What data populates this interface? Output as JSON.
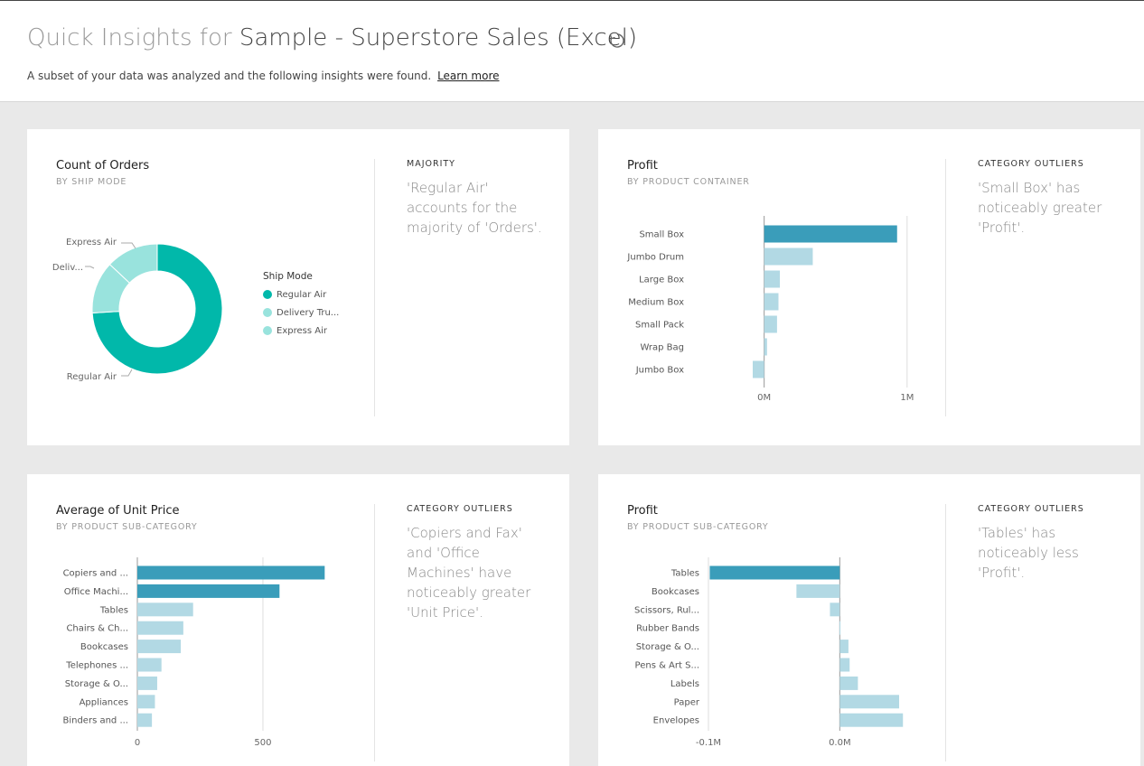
{
  "header": {
    "title_prefix": "Quick Insights for",
    "dataset_name": "Sample - Superstore Sales (Excel)",
    "subtitle": "A subset of your data was analyzed and the following insights were found.",
    "learn_more": "Learn more"
  },
  "icons": {
    "refresh": "refresh-icon"
  },
  "colors": {
    "highlight": "#3a9dba",
    "normal": "#b2d9e4",
    "donut_primary": "#01b8aa",
    "donut_secondary": "#99e3dd"
  },
  "cards": [
    {
      "title": "Count of Orders",
      "subtitle": "BY SHIP MODE",
      "insight_type": "MAJORITY",
      "insight_text": "'Regular Air' accounts for the majority of 'Orders'.",
      "legend_title": "Ship Mode",
      "slice_labels": [
        "Express Air",
        "Deliv...",
        "Regular Air"
      ],
      "legend_labels": [
        "Regular Air",
        "Delivery Tru...",
        "Express Air"
      ]
    },
    {
      "title": "Profit",
      "subtitle": "BY PRODUCT CONTAINER",
      "insight_type": "CATEGORY OUTLIERS",
      "insight_text": "'Small Box' has noticeably greater 'Profit'."
    },
    {
      "title": "Average of Unit Price",
      "subtitle": "BY PRODUCT SUB-CATEGORY",
      "insight_type": "CATEGORY OUTLIERS",
      "insight_text": "'Copiers and Fax' and 'Office Machines' have noticeably greater 'Unit Price'."
    },
    {
      "title": "Profit",
      "subtitle": "BY PRODUCT SUB-CATEGORY",
      "insight_type": "CATEGORY OUTLIERS",
      "insight_text": "'Tables' has noticeably less 'Profit'."
    }
  ],
  "chart_data": [
    {
      "type": "pie",
      "title": "Count of Orders",
      "categories": [
        "Regular Air",
        "Delivery Truck",
        "Express Air"
      ],
      "values": [
        74,
        13,
        13
      ],
      "legend_title": "Ship Mode",
      "legend": "right"
    },
    {
      "type": "bar",
      "orientation": "horizontal",
      "title": "Profit",
      "xlabel": "",
      "ylabel": "",
      "categories": [
        "Small Box",
        "Jumbo Drum",
        "Large Box",
        "Medium Box",
        "Small Pack",
        "Wrap Bag",
        "Jumbo Box"
      ],
      "values": [
        0.93,
        0.34,
        0.11,
        0.1,
        0.09,
        0.02,
        -0.08
      ],
      "highlight": [
        0
      ],
      "xlim": [
        -0.08,
        1.02
      ],
      "ticks": [
        0,
        1
      ],
      "tick_labels": [
        "0M",
        "1M"
      ],
      "grid": true
    },
    {
      "type": "bar",
      "orientation": "horizontal",
      "title": "Average of Unit Price",
      "xlabel": "",
      "ylabel": "",
      "categories": [
        "Copiers and ...",
        "Office Machi...",
        "Tables",
        "Chairs & Ch...",
        "Bookcases",
        "Telephones ...",
        "Storage & O...",
        "Appliances",
        "Binders and ..."
      ],
      "values": [
        746,
        566,
        222,
        183,
        173,
        96,
        79,
        70,
        58
      ],
      "highlight": [
        0,
        1
      ],
      "xlim": [
        0,
        770
      ],
      "ticks": [
        0,
        500
      ],
      "tick_labels": [
        "0",
        "500"
      ],
      "grid": true
    },
    {
      "type": "bar",
      "orientation": "horizontal",
      "title": "Profit",
      "xlabel": "",
      "ylabel": "",
      "categories": [
        "Tables",
        "Bookcases",
        "Scissors, Rul...",
        "Rubber Bands",
        "Storage & O...",
        "Pens & Art S...",
        "Labels",
        "Paper",
        "Envelopes"
      ],
      "values": [
        -0.099,
        -0.033,
        -0.0075,
        -0.0002,
        0.0066,
        0.0075,
        0.0138,
        0.0452,
        0.0481
      ],
      "highlight": [
        0
      ],
      "xlim": [
        -0.1,
        0.05
      ],
      "ticks": [
        -0.1,
        0
      ],
      "tick_labels": [
        "-0.1M",
        "0.0M"
      ],
      "grid": true
    }
  ]
}
